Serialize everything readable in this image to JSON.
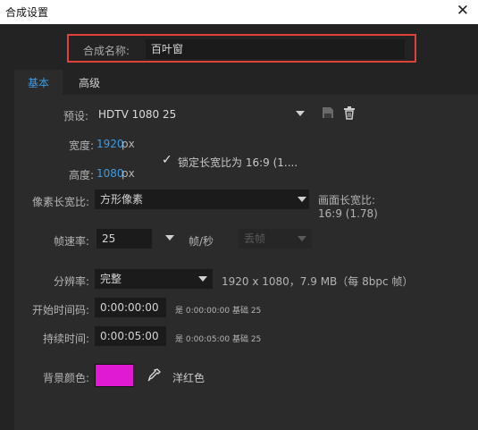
{
  "window": {
    "title": "合成设置",
    "close_glyph": "✕"
  },
  "comp_name": {
    "label": "合成名称:",
    "value": "百叶窗"
  },
  "tabs": [
    {
      "label": "基本"
    },
    {
      "label": "高级"
    }
  ],
  "preset": {
    "label": "预设:",
    "value": "HDTV 1080 25",
    "save_icon": "save-preset-icon",
    "delete_icon": "trash-icon"
  },
  "width": {
    "label": "宽度:",
    "value": "1920",
    "unit": "px"
  },
  "height": {
    "label": "高度:",
    "value": "1080",
    "unit": "px"
  },
  "lock_aspect": {
    "checkmark": "✓",
    "label": "锁定长宽比为 16:9 (1...."
  },
  "pixel_aspect": {
    "label": "像素长宽比:",
    "value": "方形像素",
    "frame_aspect_label": "画面长宽比:",
    "frame_aspect_value": "16:9 (1.78)"
  },
  "frame_rate": {
    "label": "帧速率:",
    "value": "25",
    "unit": "帧/秒",
    "drop_frame": "丢帧"
  },
  "resolution": {
    "label": "分辨率:",
    "value": "完整",
    "info": "1920 x 1080，7.9 MB（每 8bpc 帧）"
  },
  "start_timecode": {
    "label": "开始时间码:",
    "value": "0:00:00:00",
    "is_label": "是",
    "is_value": "0:00:00:00",
    "base": "基础 25"
  },
  "duration": {
    "label": "持续时间:",
    "value": "0:00:05:00",
    "is_label": "是",
    "is_value": "0:00:05:00",
    "base": "基础 25"
  },
  "background": {
    "label": "背景颜色:",
    "color": "#e01ad0",
    "name": "洋红色",
    "eyedropper_icon": "eyedropper-icon"
  },
  "colors": {
    "accent": "#3d9be4",
    "highlight_border": "#e0413a",
    "panel": "#2b2b2b",
    "field": "#1b1b1b"
  }
}
